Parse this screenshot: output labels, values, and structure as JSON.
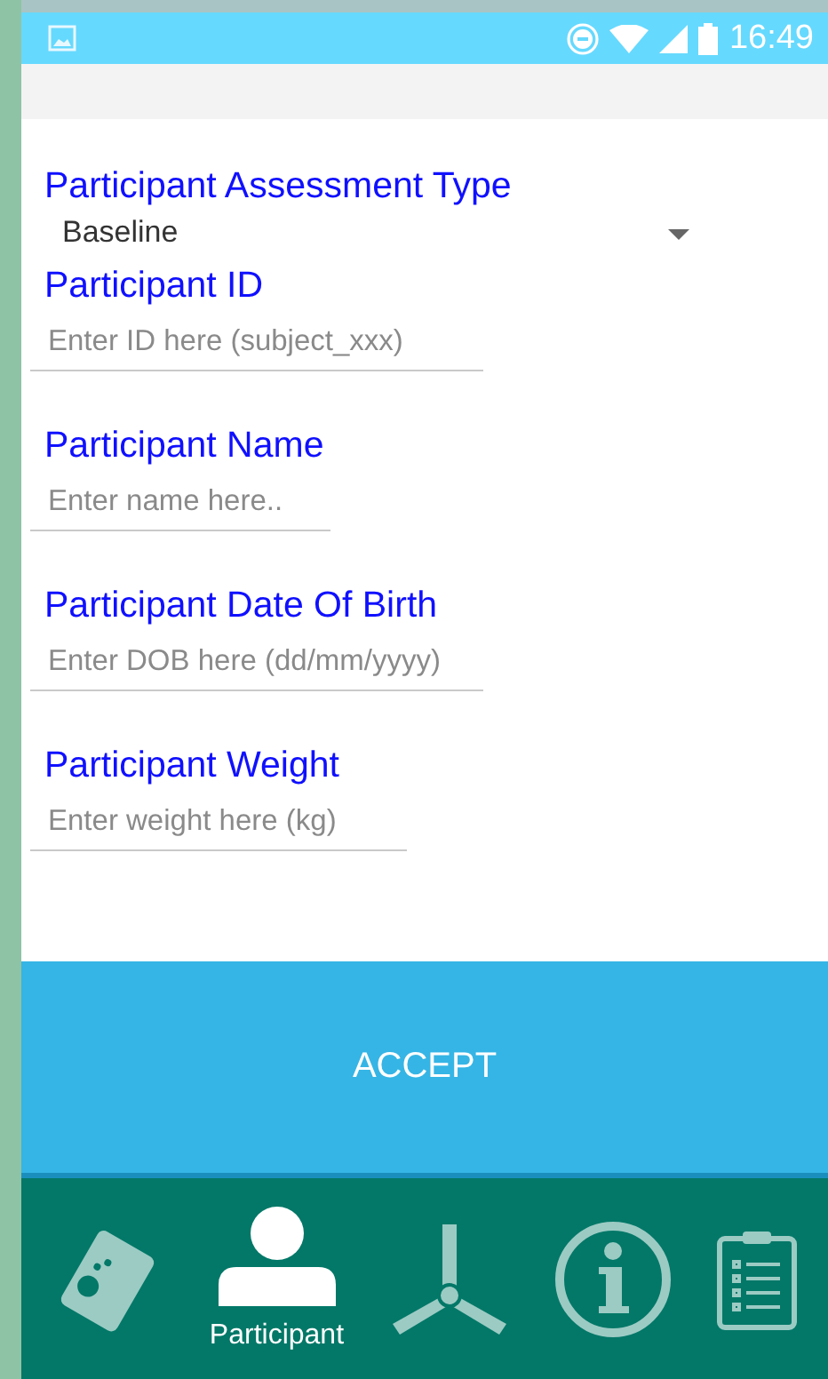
{
  "status_bar": {
    "time": "16:49"
  },
  "form": {
    "dropdown": {
      "label": "Participant Assessment Type",
      "value": "Baseline"
    },
    "fields": [
      {
        "label": "Participant ID",
        "placeholder": "Enter ID here (subject_xxx)"
      },
      {
        "label": "Participant Name",
        "placeholder": "Enter name here.."
      },
      {
        "label": "Participant Date Of Birth",
        "placeholder": "Enter DOB here (dd/mm/yyyy)"
      },
      {
        "label": "Participant Weight",
        "placeholder": "Enter weight here (kg)"
      }
    ]
  },
  "accept_button": "ACCEPT",
  "nav": {
    "items": [
      {
        "kind": "card",
        "selected": false
      },
      {
        "kind": "person",
        "label": "Participant",
        "selected": true
      },
      {
        "kind": "fan",
        "selected": false
      },
      {
        "kind": "info",
        "selected": false
      },
      {
        "kind": "clipboard",
        "selected": false
      }
    ]
  }
}
